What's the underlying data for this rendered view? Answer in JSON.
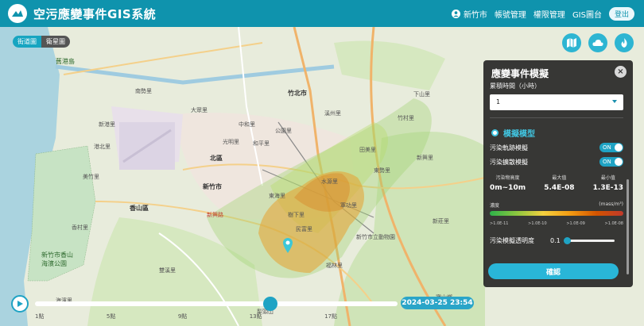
{
  "header": {
    "title": "空污應變事件GIS系統",
    "user": "新竹市",
    "nav": [
      "帳號管理",
      "權限管理",
      "GIS圖台"
    ],
    "logout": "登出"
  },
  "basemap": {
    "street": "街道圖",
    "satellite": "衛星圖"
  },
  "map_buttons": [
    "map-icon",
    "cloud-icon",
    "fire-icon"
  ],
  "map_labels": {
    "cities": [
      "新竹市",
      "竹北市",
      "香山區",
      "北區"
    ],
    "places": [
      "犁頭山",
      "大眾里",
      "美竹里",
      "新港里",
      "和平里",
      "東海里",
      "下山里",
      "新莊里",
      "軍功里",
      "南勢里",
      "溪州里",
      "民富里",
      "田美里",
      "港北里",
      "中和里",
      "福林里",
      "東勢里",
      "竹村里",
      "光明里",
      "公園里",
      "樹下里",
      "水源里",
      "新興里",
      "寶山鄉",
      "新興路",
      "新竹市立動物園",
      "雙溪里",
      "香村里",
      "海濱里"
    ],
    "green": [
      "新竹市香山海濱公園",
      "舊港島"
    ]
  },
  "panel": {
    "title": "應變事件模擬",
    "close": "×",
    "duration_label": "累積時間（小時）",
    "duration_value": "1",
    "section": "模擬模型",
    "toggle1_label": "污染軌跡模擬",
    "toggle2_label": "污染擴散模擬",
    "toggle_on": "ON",
    "stats": [
      {
        "head": "污染物高度",
        "value": "0m~10m"
      },
      {
        "head": "最大值",
        "value": "5.4E-08"
      },
      {
        "head": "最小值",
        "value": "1.3E-13"
      }
    ],
    "legend_title": "濃度",
    "legend_unit": "(mass/m³)",
    "legend_ticks": [
      ">1.0E-11",
      ">1.0E-10",
      ">1.0E-09",
      ">1.0E-08"
    ],
    "opacity_label": "污染模擬透明度",
    "opacity_value": "0.1",
    "confirm": "確認"
  },
  "timeline": {
    "current_time": "2024-03-25 23:54",
    "progress": 0.65,
    "labels": [
      "1點",
      "5點",
      "9點",
      "13點",
      "17點"
    ]
  },
  "colors": {
    "accent": "#0f93ad",
    "plume_orange": "#e8a030",
    "plume_green": "#9bd06b"
  }
}
